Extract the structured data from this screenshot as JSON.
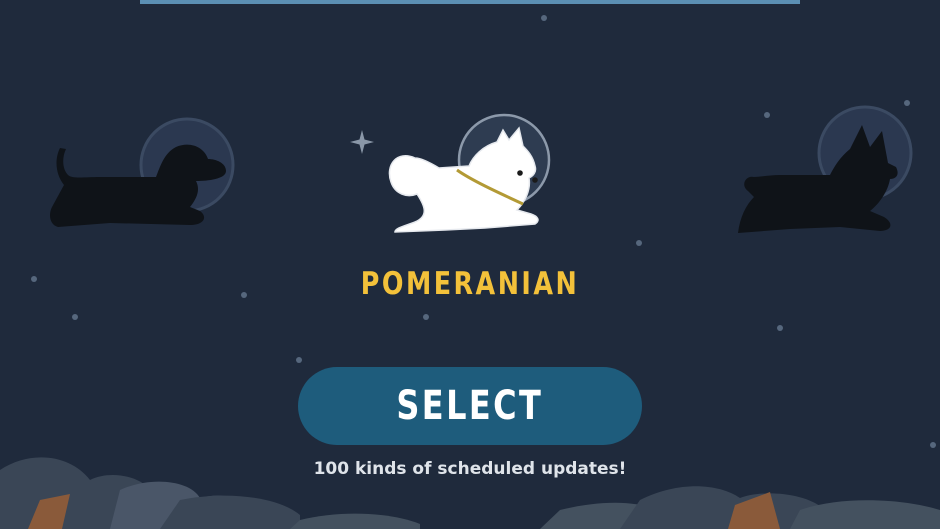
{
  "breed": {
    "name": "POMERANIAN"
  },
  "select_button": {
    "label": "SELECT"
  },
  "footer": {
    "text": "100 kinds of scheduled updates!"
  },
  "icons": [
    "left-dog-silhouette-icon",
    "pomeranian-dog-icon",
    "right-dog-silhouette-icon",
    "sparkle-star-icon"
  ],
  "colors": {
    "background": "#1f2a3c",
    "accent": "#f3c13a",
    "button": "#1e5c7c"
  }
}
